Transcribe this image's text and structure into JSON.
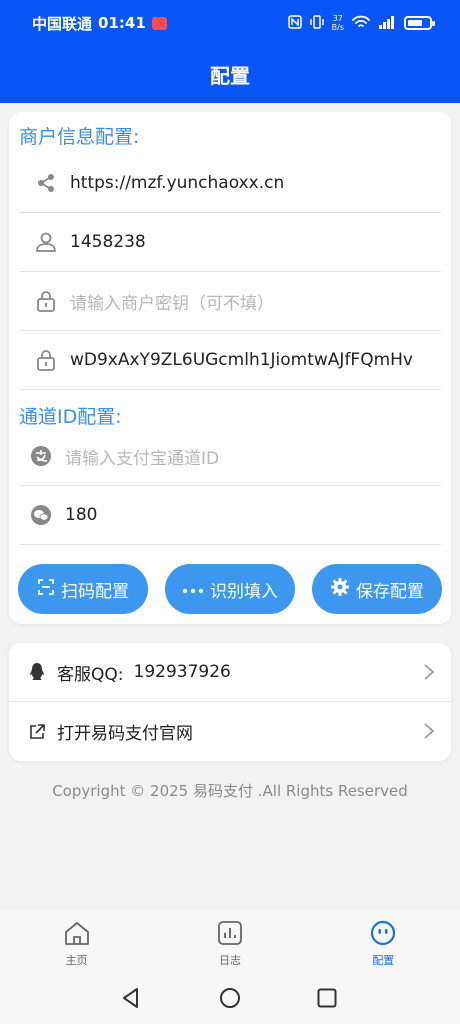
{
  "status_bar": {
    "carrier": "中国联通",
    "time": "01:41",
    "net_speed_top": "37",
    "net_speed_bottom": "B/s"
  },
  "header": {
    "title": "配置"
  },
  "merchant": {
    "section_title": "商户信息配置:",
    "url": "https://mzf.yunchaoxx.cn",
    "merchant_id": "1458238",
    "merchant_key_placeholder": "请输入商户密钥（可不填）",
    "secret": "wD9xAxY9ZL6UGcmlh1JiomtwAJfFQmHv"
  },
  "channel": {
    "section_title": "通道ID配置:",
    "alipay_placeholder": "请输入支付宝通道ID",
    "wechat_value": "180"
  },
  "actions": {
    "scan_label": "扫码配置",
    "recognize_label": "识别填入",
    "save_label": "保存配置"
  },
  "links": {
    "support_label": "客服QQ:",
    "support_qq": "192937926",
    "website_label": "打开易码支付官网"
  },
  "footer": {
    "copyright": "Copyright © 2025 易码支付 .All Rights Reserved"
  },
  "tabs": [
    {
      "label": "主页"
    },
    {
      "label": "日志"
    },
    {
      "label": "配置",
      "active": true
    }
  ],
  "colors": {
    "header_bg": "#0a55f5",
    "accent": "#3d97ee",
    "section_title": "#3b8fe5",
    "active_tab": "#1e6fe0"
  }
}
